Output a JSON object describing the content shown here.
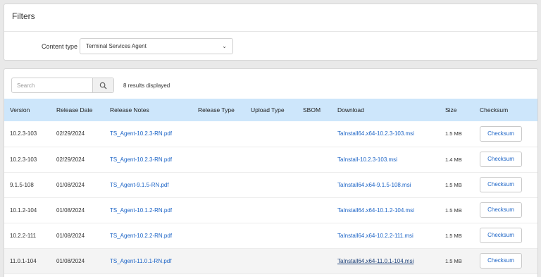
{
  "filters": {
    "title": "Filters",
    "content_type_label": "Content type",
    "content_type_value": "Terminal Services Agent"
  },
  "search": {
    "placeholder": "Search",
    "results_text": "8 results displayed"
  },
  "table": {
    "columns": [
      "Version",
      "Release Date",
      "Release Notes",
      "Release Type",
      "Upload Type",
      "SBOM",
      "Download",
      "Size",
      "Checksum"
    ],
    "rows": [
      {
        "version": "10.2.3-103",
        "date": "02/29/2024",
        "notes": "TS_Agent-10.2.3-RN.pdf",
        "release_type": "",
        "upload_type": "",
        "sbom": "",
        "download": "TaInstall64.x64-10.2.3-103.msi",
        "size": "1.5 MB",
        "checksum": "Checksum"
      },
      {
        "version": "10.2.3-103",
        "date": "02/29/2024",
        "notes": "TS_Agent-10.2.3-RN.pdf",
        "release_type": "",
        "upload_type": "",
        "sbom": "",
        "download": "TaInstall-10.2.3-103.msi",
        "size": "1.4 MB",
        "checksum": "Checksum"
      },
      {
        "version": "9.1.5-108",
        "date": "01/08/2024",
        "notes": "TS_Agent-9.1.5-RN.pdf",
        "release_type": "",
        "upload_type": "",
        "sbom": "",
        "download": "TaInstall64.x64-9.1.5-108.msi",
        "size": "1.5 MB",
        "checksum": "Checksum"
      },
      {
        "version": "10.1.2-104",
        "date": "01/08/2024",
        "notes": "TS_Agent-10.1.2-RN.pdf",
        "release_type": "",
        "upload_type": "",
        "sbom": "",
        "download": "TaInstall64.x64-10.1.2-104.msi",
        "size": "1.5 MB",
        "checksum": "Checksum"
      },
      {
        "version": "10.2.2-111",
        "date": "01/08/2024",
        "notes": "TS_Agent-10.2.2-RN.pdf",
        "release_type": "",
        "upload_type": "",
        "sbom": "",
        "download": "TaInstall64.x64-10.2.2-111.msi",
        "size": "1.5 MB",
        "checksum": "Checksum"
      },
      {
        "version": "11.0.1-104",
        "date": "01/08/2024",
        "notes": "TS_Agent-11.0.1-RN.pdf",
        "release_type": "",
        "upload_type": "",
        "sbom": "",
        "download": "TaInstall64.x64-11.0.1-104.msi",
        "size": "1.5 MB",
        "checksum": "Checksum"
      }
    ]
  },
  "icons": {
    "search": "search-icon",
    "dropdown": "chevron-down-icon"
  },
  "colors": {
    "header_bg": "#cde6fb",
    "link": "#1c64c6"
  }
}
